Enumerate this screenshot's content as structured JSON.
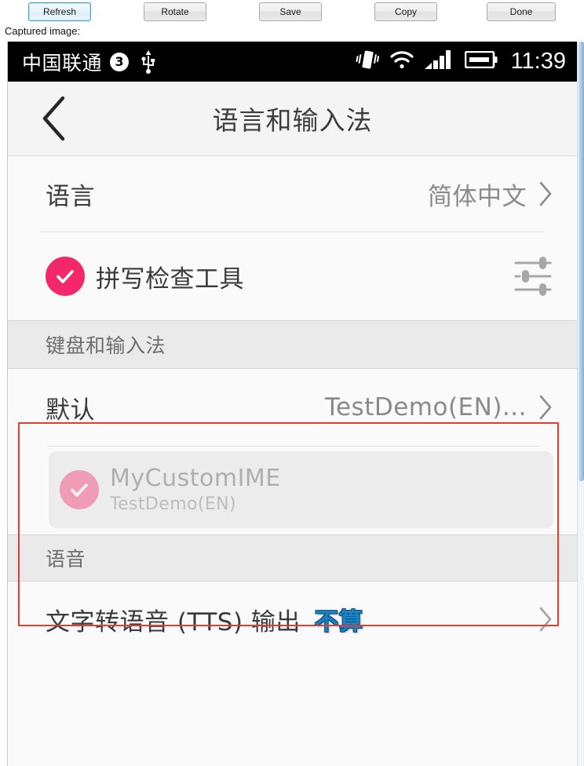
{
  "host": {
    "buttons": [
      {
        "id": "refresh",
        "label": "Refresh",
        "focused": true
      },
      {
        "id": "rotate",
        "label": "Rotate",
        "focused": false
      },
      {
        "id": "save",
        "label": "Save",
        "focused": false
      },
      {
        "id": "copy",
        "label": "Copy",
        "focused": false
      },
      {
        "id": "done",
        "label": "Done",
        "focused": false
      }
    ],
    "captured_label": "Captured image:"
  },
  "status_bar": {
    "carrier": "中国联通",
    "sim_badge": "3",
    "icons": [
      "usb-icon",
      "vibrate-icon",
      "wifi-icon",
      "signal-bars-icon",
      "battery-icon"
    ],
    "clock": "11:39",
    "background": "#000000"
  },
  "action_bar": {
    "back_icon": "chevron-left-icon",
    "title": "语言和输入法"
  },
  "sections": {
    "language_row": {
      "title": "语言",
      "value": "简体中文",
      "chevron": "chevron-right-icon"
    },
    "spell_check_row": {
      "title": "拼写检查工具",
      "checked": true,
      "check_color": "#f4276a",
      "settings_icon": "sliders-icon"
    },
    "keyboard_header": "键盘和输入法",
    "default_row": {
      "title": "默认",
      "value": "TestDemo(EN)...",
      "chevron": "chevron-right-icon"
    },
    "ime_item": {
      "title": "MyCustomIME",
      "subtitle": "TestDemo(EN)",
      "checked": true,
      "check_color": "#f4276a",
      "highlighted": true
    },
    "speech_header": "语音",
    "tts_row": {
      "title": "文字转语音 (TTS) 输出",
      "annotation": "不算",
      "annotation_color": "#1a83c6",
      "chevron": "chevron-right-icon"
    }
  },
  "annotations": {
    "red_box_color": "#e83b30"
  }
}
